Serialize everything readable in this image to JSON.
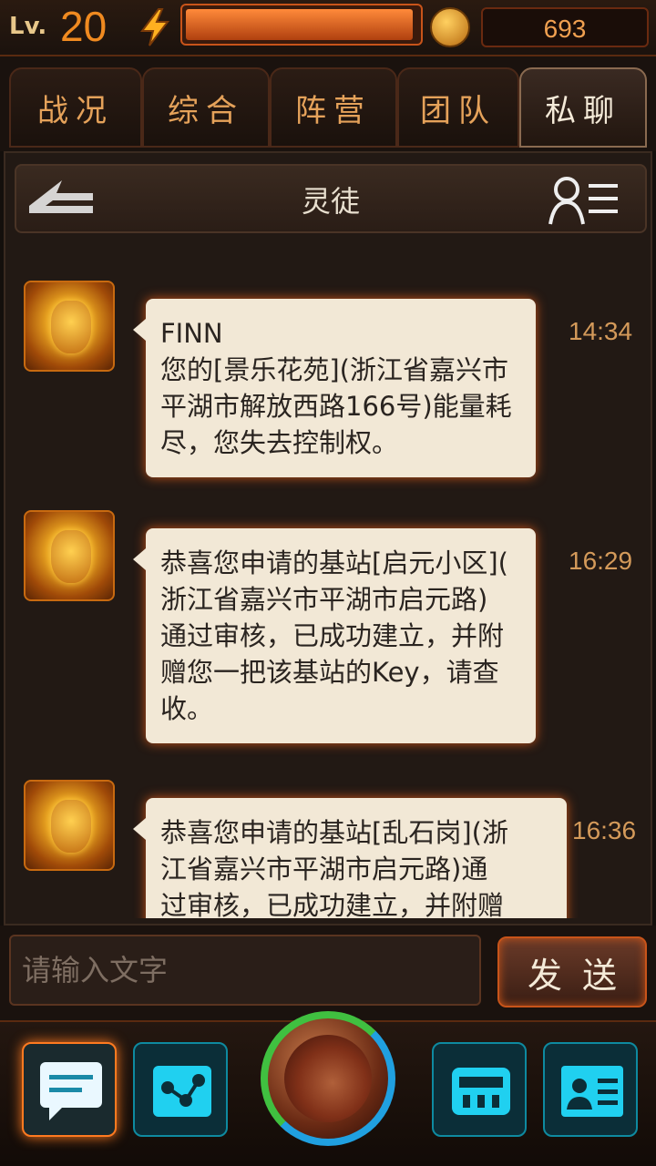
{
  "status": {
    "level_label": "Lv.",
    "level": "20",
    "energy_percent": 98,
    "coins": "693"
  },
  "tabs": [
    {
      "label": "战况",
      "active": false
    },
    {
      "label": "综合",
      "active": false
    },
    {
      "label": "阵营",
      "active": false
    },
    {
      "label": "团队",
      "active": false
    },
    {
      "label": "私聊",
      "active": true
    }
  ],
  "chat": {
    "title": "灵徒",
    "messages": [
      {
        "text": "FINN\n您的[景乐花苑](浙江省嘉兴市\n平湖市解放西路166号)能量耗\n尽，您失去控制权。",
        "time": "14:34"
      },
      {
        "text": "恭喜您申请的基站[启元小区](\n浙江省嘉兴市平湖市启元路)\n通过审核，已成功建立，并附\n赠您一把该基站的Key，请查\n收。",
        "time": "16:29"
      },
      {
        "text": "恭喜您申请的基站[乱石岗](浙\n江省嘉兴市平湖市启元路)通\n过审核，已成功建立，并附赠",
        "time": "16:36"
      }
    ]
  },
  "input": {
    "placeholder": "请输入文字",
    "send_label": "发送"
  },
  "colors": {
    "accent": "#f08a20",
    "bubble": "#f2e8d6",
    "nav_cyan": "#20d0f0"
  },
  "icons": [
    "lightning-icon",
    "coin-icon",
    "back-icon",
    "contacts-list-icon",
    "chat-icon",
    "share-icon",
    "globe-icon",
    "inventory-icon",
    "profile-card-icon"
  ]
}
